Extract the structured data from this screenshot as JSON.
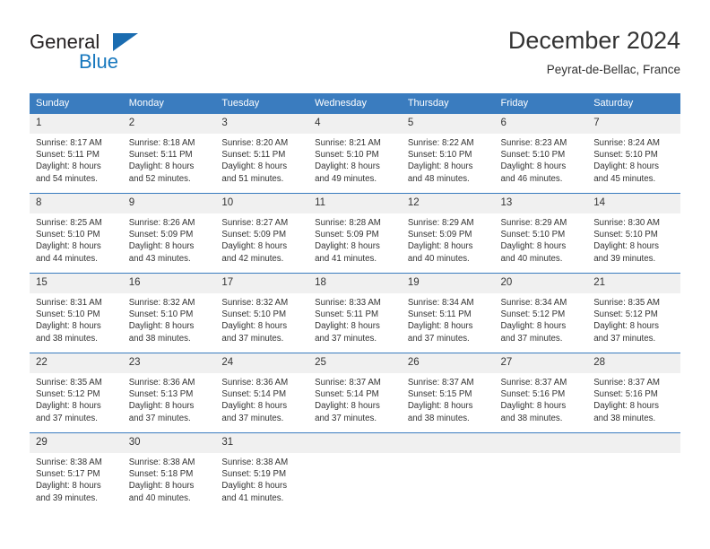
{
  "brand": {
    "name_part1": "General",
    "name_part2": "Blue",
    "triangle_icon": "triangle-icon",
    "accent_color": "#1878be"
  },
  "header": {
    "title": "December 2024",
    "subtitle": "Peyrat-de-Bellac, France"
  },
  "theme": {
    "header_bg": "#3a7cbf",
    "daynum_bg": "#f0f0f0",
    "text": "#333333"
  },
  "calendar": {
    "weekday_headers": [
      "Sunday",
      "Monday",
      "Tuesday",
      "Wednesday",
      "Thursday",
      "Friday",
      "Saturday"
    ],
    "weeks": [
      [
        {
          "day": "1",
          "sunrise": "Sunrise: 8:17 AM",
          "sunset": "Sunset: 5:11 PM",
          "daylight1": "Daylight: 8 hours",
          "daylight2": "and 54 minutes."
        },
        {
          "day": "2",
          "sunrise": "Sunrise: 8:18 AM",
          "sunset": "Sunset: 5:11 PM",
          "daylight1": "Daylight: 8 hours",
          "daylight2": "and 52 minutes."
        },
        {
          "day": "3",
          "sunrise": "Sunrise: 8:20 AM",
          "sunset": "Sunset: 5:11 PM",
          "daylight1": "Daylight: 8 hours",
          "daylight2": "and 51 minutes."
        },
        {
          "day": "4",
          "sunrise": "Sunrise: 8:21 AM",
          "sunset": "Sunset: 5:10 PM",
          "daylight1": "Daylight: 8 hours",
          "daylight2": "and 49 minutes."
        },
        {
          "day": "5",
          "sunrise": "Sunrise: 8:22 AM",
          "sunset": "Sunset: 5:10 PM",
          "daylight1": "Daylight: 8 hours",
          "daylight2": "and 48 minutes."
        },
        {
          "day": "6",
          "sunrise": "Sunrise: 8:23 AM",
          "sunset": "Sunset: 5:10 PM",
          "daylight1": "Daylight: 8 hours",
          "daylight2": "and 46 minutes."
        },
        {
          "day": "7",
          "sunrise": "Sunrise: 8:24 AM",
          "sunset": "Sunset: 5:10 PM",
          "daylight1": "Daylight: 8 hours",
          "daylight2": "and 45 minutes."
        }
      ],
      [
        {
          "day": "8",
          "sunrise": "Sunrise: 8:25 AM",
          "sunset": "Sunset: 5:10 PM",
          "daylight1": "Daylight: 8 hours",
          "daylight2": "and 44 minutes."
        },
        {
          "day": "9",
          "sunrise": "Sunrise: 8:26 AM",
          "sunset": "Sunset: 5:09 PM",
          "daylight1": "Daylight: 8 hours",
          "daylight2": "and 43 minutes."
        },
        {
          "day": "10",
          "sunrise": "Sunrise: 8:27 AM",
          "sunset": "Sunset: 5:09 PM",
          "daylight1": "Daylight: 8 hours",
          "daylight2": "and 42 minutes."
        },
        {
          "day": "11",
          "sunrise": "Sunrise: 8:28 AM",
          "sunset": "Sunset: 5:09 PM",
          "daylight1": "Daylight: 8 hours",
          "daylight2": "and 41 minutes."
        },
        {
          "day": "12",
          "sunrise": "Sunrise: 8:29 AM",
          "sunset": "Sunset: 5:09 PM",
          "daylight1": "Daylight: 8 hours",
          "daylight2": "and 40 minutes."
        },
        {
          "day": "13",
          "sunrise": "Sunrise: 8:29 AM",
          "sunset": "Sunset: 5:10 PM",
          "daylight1": "Daylight: 8 hours",
          "daylight2": "and 40 minutes."
        },
        {
          "day": "14",
          "sunrise": "Sunrise: 8:30 AM",
          "sunset": "Sunset: 5:10 PM",
          "daylight1": "Daylight: 8 hours",
          "daylight2": "and 39 minutes."
        }
      ],
      [
        {
          "day": "15",
          "sunrise": "Sunrise: 8:31 AM",
          "sunset": "Sunset: 5:10 PM",
          "daylight1": "Daylight: 8 hours",
          "daylight2": "and 38 minutes."
        },
        {
          "day": "16",
          "sunrise": "Sunrise: 8:32 AM",
          "sunset": "Sunset: 5:10 PM",
          "daylight1": "Daylight: 8 hours",
          "daylight2": "and 38 minutes."
        },
        {
          "day": "17",
          "sunrise": "Sunrise: 8:32 AM",
          "sunset": "Sunset: 5:10 PM",
          "daylight1": "Daylight: 8 hours",
          "daylight2": "and 37 minutes."
        },
        {
          "day": "18",
          "sunrise": "Sunrise: 8:33 AM",
          "sunset": "Sunset: 5:11 PM",
          "daylight1": "Daylight: 8 hours",
          "daylight2": "and 37 minutes."
        },
        {
          "day": "19",
          "sunrise": "Sunrise: 8:34 AM",
          "sunset": "Sunset: 5:11 PM",
          "daylight1": "Daylight: 8 hours",
          "daylight2": "and 37 minutes."
        },
        {
          "day": "20",
          "sunrise": "Sunrise: 8:34 AM",
          "sunset": "Sunset: 5:12 PM",
          "daylight1": "Daylight: 8 hours",
          "daylight2": "and 37 minutes."
        },
        {
          "day": "21",
          "sunrise": "Sunrise: 8:35 AM",
          "sunset": "Sunset: 5:12 PM",
          "daylight1": "Daylight: 8 hours",
          "daylight2": "and 37 minutes."
        }
      ],
      [
        {
          "day": "22",
          "sunrise": "Sunrise: 8:35 AM",
          "sunset": "Sunset: 5:12 PM",
          "daylight1": "Daylight: 8 hours",
          "daylight2": "and 37 minutes."
        },
        {
          "day": "23",
          "sunrise": "Sunrise: 8:36 AM",
          "sunset": "Sunset: 5:13 PM",
          "daylight1": "Daylight: 8 hours",
          "daylight2": "and 37 minutes."
        },
        {
          "day": "24",
          "sunrise": "Sunrise: 8:36 AM",
          "sunset": "Sunset: 5:14 PM",
          "daylight1": "Daylight: 8 hours",
          "daylight2": "and 37 minutes."
        },
        {
          "day": "25",
          "sunrise": "Sunrise: 8:37 AM",
          "sunset": "Sunset: 5:14 PM",
          "daylight1": "Daylight: 8 hours",
          "daylight2": "and 37 minutes."
        },
        {
          "day": "26",
          "sunrise": "Sunrise: 8:37 AM",
          "sunset": "Sunset: 5:15 PM",
          "daylight1": "Daylight: 8 hours",
          "daylight2": "and 38 minutes."
        },
        {
          "day": "27",
          "sunrise": "Sunrise: 8:37 AM",
          "sunset": "Sunset: 5:16 PM",
          "daylight1": "Daylight: 8 hours",
          "daylight2": "and 38 minutes."
        },
        {
          "day": "28",
          "sunrise": "Sunrise: 8:37 AM",
          "sunset": "Sunset: 5:16 PM",
          "daylight1": "Daylight: 8 hours",
          "daylight2": "and 38 minutes."
        }
      ],
      [
        {
          "day": "29",
          "sunrise": "Sunrise: 8:38 AM",
          "sunset": "Sunset: 5:17 PM",
          "daylight1": "Daylight: 8 hours",
          "daylight2": "and 39 minutes."
        },
        {
          "day": "30",
          "sunrise": "Sunrise: 8:38 AM",
          "sunset": "Sunset: 5:18 PM",
          "daylight1": "Daylight: 8 hours",
          "daylight2": "and 40 minutes."
        },
        {
          "day": "31",
          "sunrise": "Sunrise: 8:38 AM",
          "sunset": "Sunset: 5:19 PM",
          "daylight1": "Daylight: 8 hours",
          "daylight2": "and 41 minutes."
        },
        {
          "day": "",
          "sunrise": "",
          "sunset": "",
          "daylight1": "",
          "daylight2": ""
        },
        {
          "day": "",
          "sunrise": "",
          "sunset": "",
          "daylight1": "",
          "daylight2": ""
        },
        {
          "day": "",
          "sunrise": "",
          "sunset": "",
          "daylight1": "",
          "daylight2": ""
        },
        {
          "day": "",
          "sunrise": "",
          "sunset": "",
          "daylight1": "",
          "daylight2": ""
        }
      ]
    ]
  }
}
